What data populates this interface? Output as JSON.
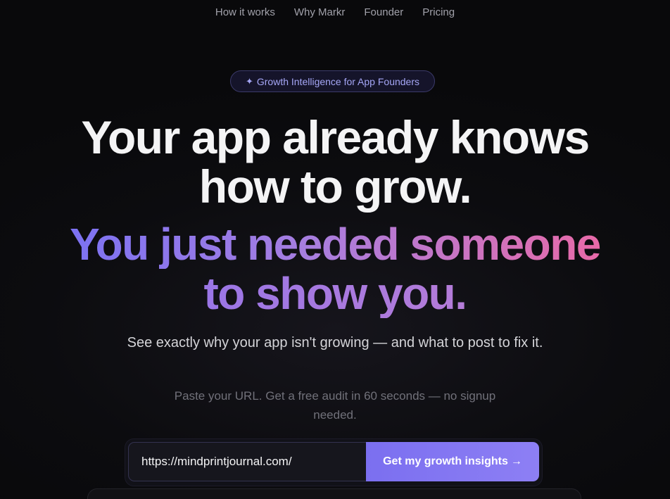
{
  "nav": {
    "items": [
      {
        "label": "How it works"
      },
      {
        "label": "Why Markr"
      },
      {
        "label": "Founder"
      },
      {
        "label": "Pricing"
      }
    ]
  },
  "badge": {
    "icon": "sparkle-icon",
    "icon_glyph": "✦",
    "label": "Growth Intelligence for App Founders"
  },
  "hero": {
    "headline_line1": "Your app already knows",
    "headline_line2": "how to grow.",
    "subhead_line1": "You just needed someone",
    "subhead_line2": "to show you.",
    "description": "See exactly why your app isn't growing — and what to post to fix it.",
    "note": "Paste your URL. Get a free audit in 60 seconds — no signup needed."
  },
  "form": {
    "url_value": "https://mindprintjournal.com/",
    "cta_label": "Get my growth insights",
    "cta_arrow": "→"
  },
  "colors": {
    "background": "#09090b",
    "accent": "#7b6ff0",
    "gradient_start": "#7c72f2",
    "gradient_end": "#e86aa8"
  }
}
